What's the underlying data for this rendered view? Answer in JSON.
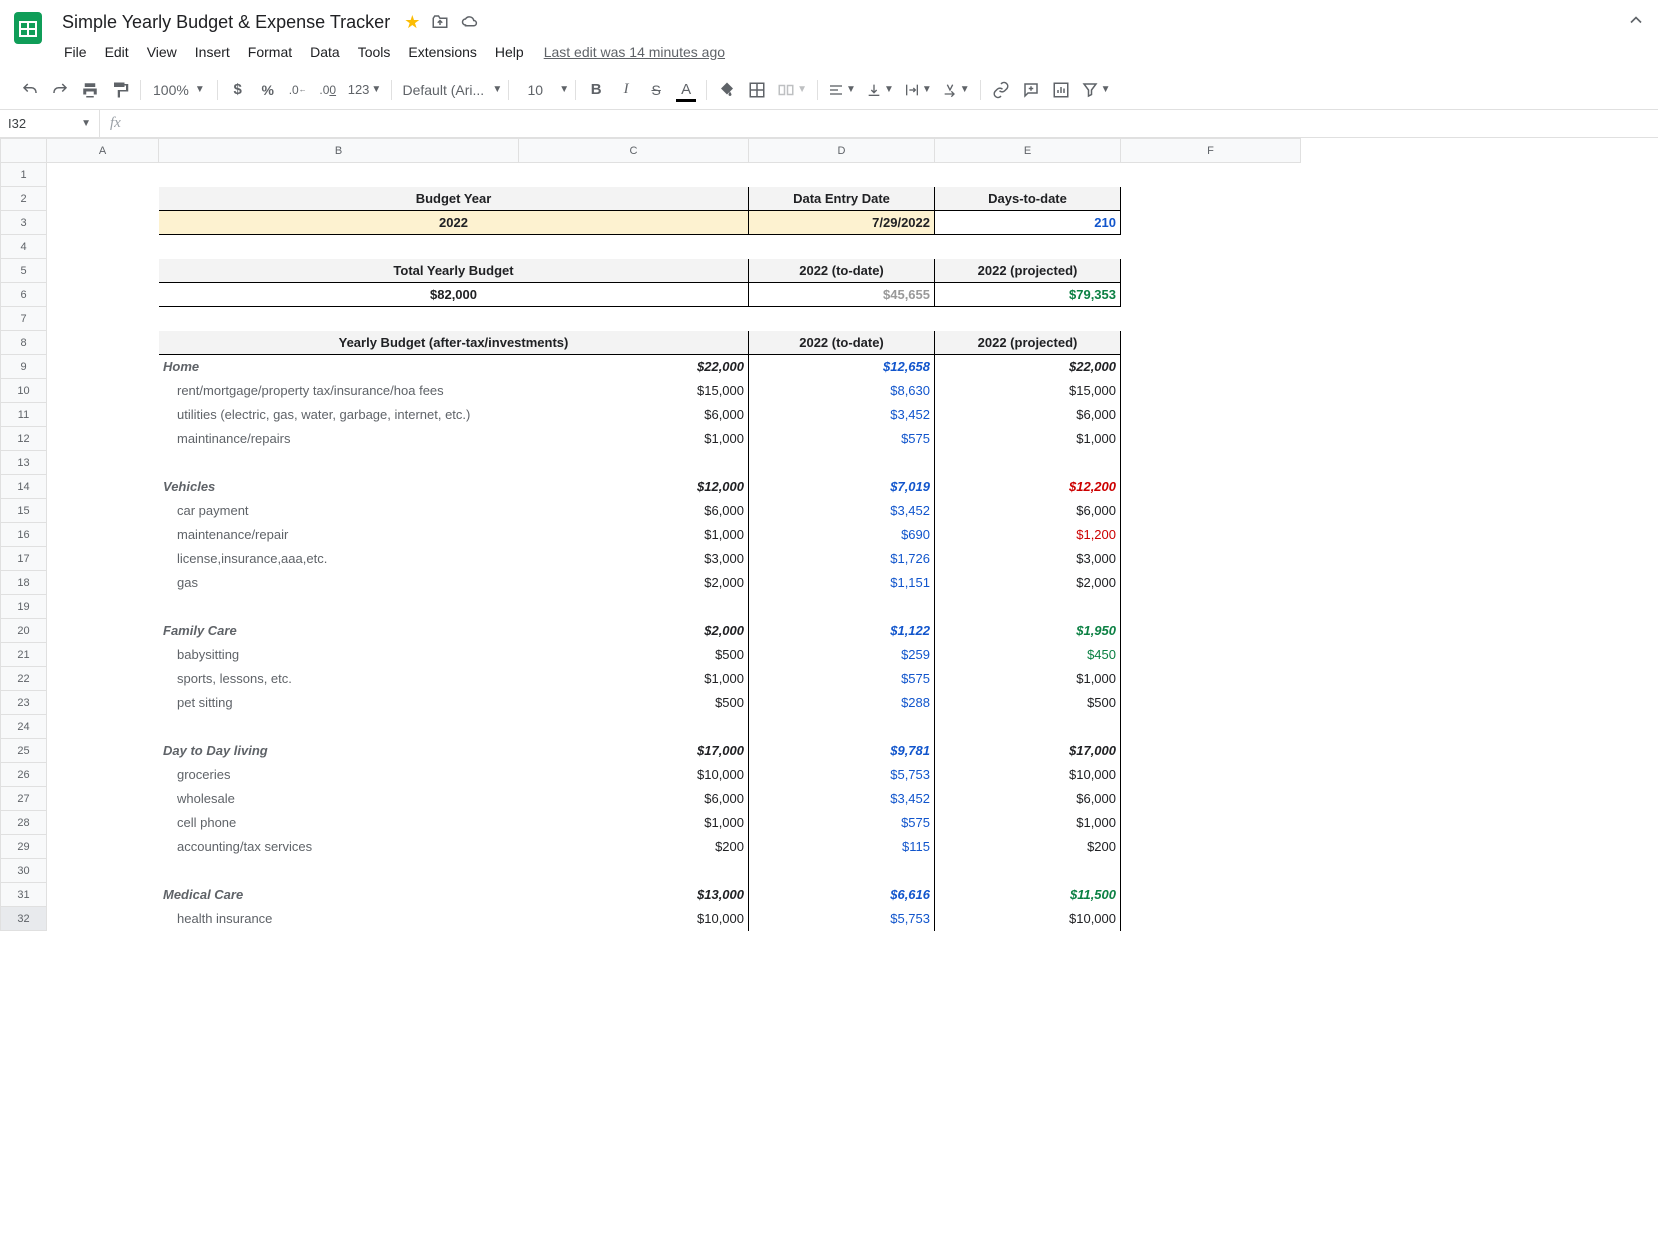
{
  "doc": {
    "title": "Simple Yearly Budget & Expense Tracker",
    "last_edit": "Last edit was 14 minutes ago"
  },
  "menus": [
    "File",
    "Edit",
    "View",
    "Insert",
    "Format",
    "Data",
    "Tools",
    "Extensions",
    "Help"
  ],
  "toolbar": {
    "zoom": "100%",
    "font": "Default (Ari...",
    "font_size": "10",
    "format_auto": "123"
  },
  "namebox": {
    "cell": "I32",
    "fx": "fx"
  },
  "columns": [
    "A",
    "B",
    "C",
    "D",
    "E",
    "F"
  ],
  "sheet": {
    "h1": {
      "b": "Budget Year",
      "d": "Data Entry Date",
      "e": "Days-to-date"
    },
    "h2": {
      "b": "2022",
      "d": "7/29/2022",
      "e": "210"
    },
    "tot": {
      "b": "Total Yearly Budget",
      "d": "2022 (to-date)",
      "e": "2022 (projected)"
    },
    "totv": {
      "b": "$82,000",
      "d": "$45,655",
      "e": "$79,353"
    },
    "bud": {
      "b": "Yearly Budget (after-tax/investments)",
      "d": "2022 (to-date)",
      "e": "2022 (projected)"
    },
    "cats": [
      {
        "name": "Home",
        "b": "$22,000",
        "d": "$12,658",
        "e": "$22,000",
        "ecolor": "black",
        "items": [
          {
            "l": "rent/mortgage/property tax/insurance/hoa fees",
            "b": "$15,000",
            "d": "$8,630",
            "e": "$15,000"
          },
          {
            "l": "utilities (electric, gas, water, garbage, internet, etc.)",
            "b": "$6,000",
            "d": "$3,452",
            "e": "$6,000"
          },
          {
            "l": "maintinance/repairs",
            "b": "$1,000",
            "d": "$575",
            "e": "$1,000"
          }
        ]
      },
      {
        "name": "Vehicles",
        "b": "$12,000",
        "d": "$7,019",
        "e": "$12,200",
        "ecolor": "red",
        "items": [
          {
            "l": "car payment",
            "b": "$6,000",
            "d": "$3,452",
            "e": "$6,000"
          },
          {
            "l": "maintenance/repair",
            "b": "$1,000",
            "d": "$690",
            "e": "$1,200",
            "ecolor": "red"
          },
          {
            "l": "license,insurance,aaa,etc.",
            "b": "$3,000",
            "d": "$1,726",
            "e": "$3,000"
          },
          {
            "l": "gas",
            "b": "$2,000",
            "d": "$1,151",
            "e": "$2,000"
          }
        ]
      },
      {
        "name": "Family Care",
        "b": "$2,000",
        "d": "$1,122",
        "e": "$1,950",
        "ecolor": "green",
        "items": [
          {
            "l": "babysitting",
            "b": "$500",
            "d": "$259",
            "e": "$450",
            "ecolor": "green"
          },
          {
            "l": "sports, lessons, etc.",
            "b": "$1,000",
            "d": "$575",
            "e": "$1,000"
          },
          {
            "l": "pet sitting",
            "b": "$500",
            "d": "$288",
            "e": "$500"
          }
        ]
      },
      {
        "name": "Day to Day living",
        "b": "$17,000",
        "d": "$9,781",
        "e": "$17,000",
        "ecolor": "black",
        "items": [
          {
            "l": "groceries",
            "b": "$10,000",
            "d": "$5,753",
            "e": "$10,000"
          },
          {
            "l": "wholesale",
            "b": "$6,000",
            "d": "$3,452",
            "e": "$6,000"
          },
          {
            "l": "cell phone",
            "b": "$1,000",
            "d": "$575",
            "e": "$1,000"
          },
          {
            "l": "accounting/tax services",
            "b": "$200",
            "d": "$115",
            "e": "$200"
          }
        ]
      },
      {
        "name": "Medical Care",
        "b": "$13,000",
        "d": "$6,616",
        "e": "$11,500",
        "ecolor": "green",
        "items": [
          {
            "l": "health insurance",
            "b": "$10,000",
            "d": "$5,753",
            "e": "$10,000"
          }
        ]
      }
    ]
  }
}
